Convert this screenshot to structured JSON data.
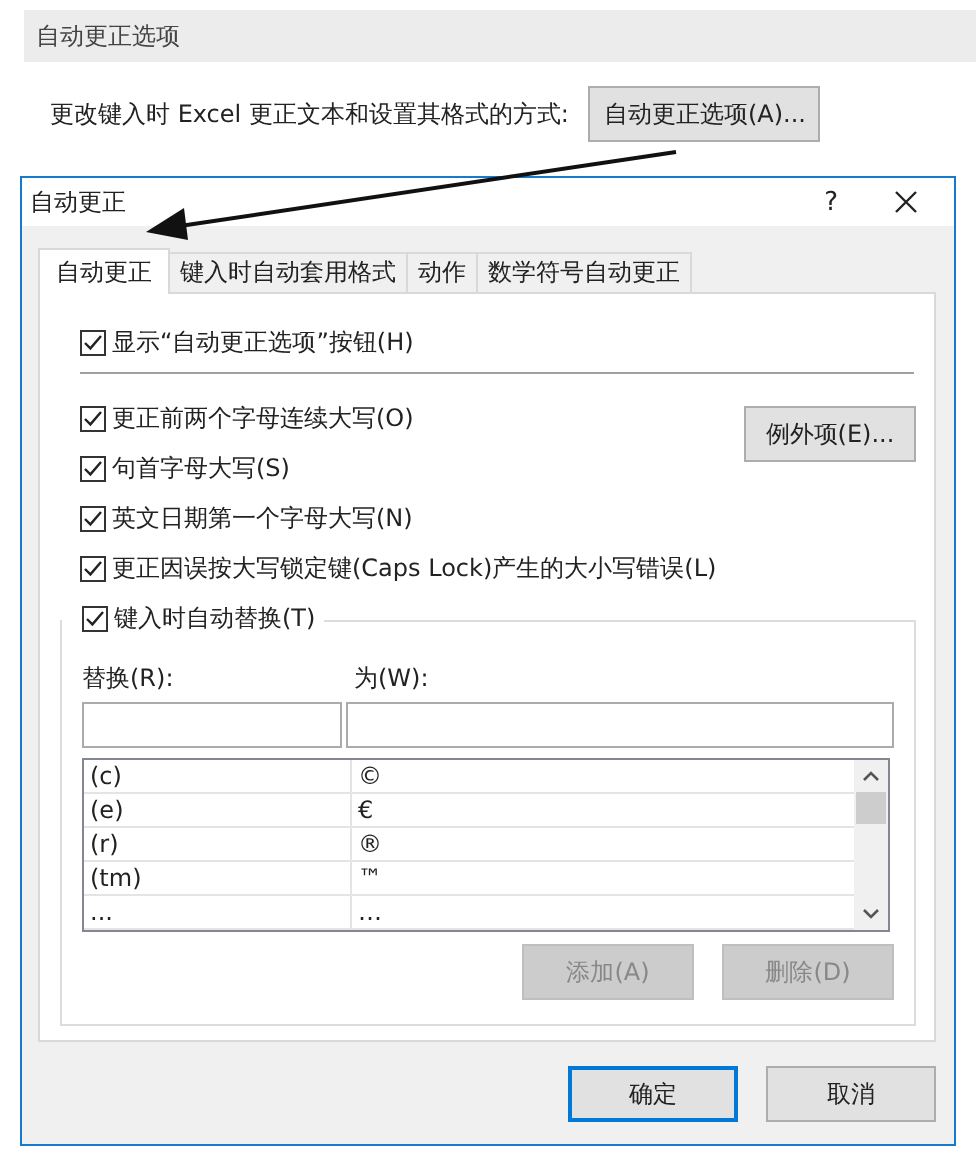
{
  "page": {
    "section_title": "自动更正选项",
    "description": "更改键入时 Excel 更正文本和设置其格式的方式:",
    "button": "自动更正选项(A)..."
  },
  "dialog": {
    "title": "自动更正",
    "help": "?",
    "tabs": [
      {
        "label": "自动更正",
        "selected": true
      },
      {
        "label": "键入时自动套用格式",
        "selected": false
      },
      {
        "label": "动作",
        "selected": false
      },
      {
        "label": "数学符号自动更正",
        "selected": false
      }
    ],
    "show_button_option": {
      "label": "显示“自动更正选项”按钮(H)",
      "checked": true
    },
    "options": [
      {
        "label": "更正前两个字母连续大写(O)",
        "checked": true
      },
      {
        "label": "句首字母大写(S)",
        "checked": true
      },
      {
        "label": "英文日期第一个字母大写(N)",
        "checked": true
      },
      {
        "label": "更正因误按大写锁定键(Caps Lock)产生的大小写错误(L)",
        "checked": true
      }
    ],
    "exceptions_button": "例外项(E)...",
    "replace_group": {
      "label": "键入时自动替换(T)",
      "checked": true,
      "replace_label": "替换(R):",
      "with_label": "为(W):",
      "rows": [
        {
          "replace": "(c)",
          "with": "©"
        },
        {
          "replace": "(e)",
          "with": "€"
        },
        {
          "replace": "(r)",
          "with": "®"
        },
        {
          "replace": "(tm)",
          "with": "™"
        },
        {
          "replace": "...",
          "with": "…"
        }
      ],
      "buttons": [
        {
          "label": "添加(A)",
          "disabled": true
        },
        {
          "label": "删除(D)",
          "disabled": true
        }
      ]
    },
    "footer_buttons": [
      {
        "label": "确定",
        "default": true
      },
      {
        "label": "取消",
        "default": false
      }
    ]
  }
}
